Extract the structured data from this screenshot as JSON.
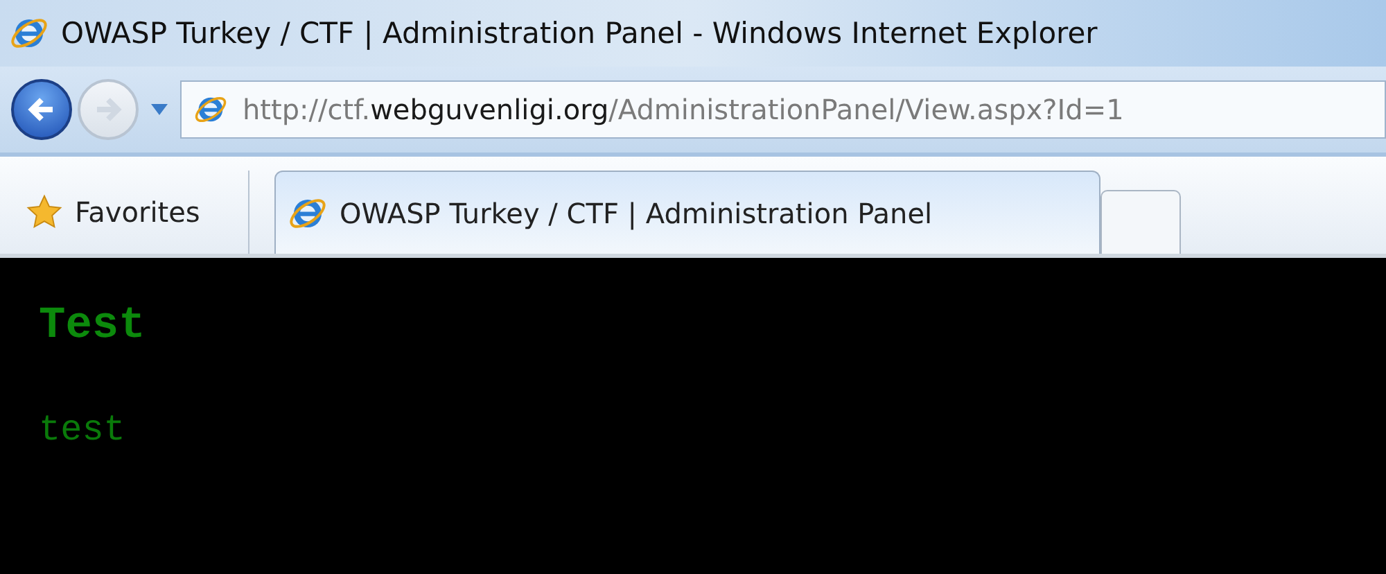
{
  "window": {
    "title": "OWASP Turkey / CTF | Administration Panel - Windows Internet Explorer"
  },
  "address_bar": {
    "url_prefix": "http://ctf.",
    "url_domain": "webguvenligi.org",
    "url_path": "/AdministrationPanel/View.aspx?Id=1"
  },
  "favorites": {
    "label": "Favorites"
  },
  "tabs": [
    {
      "label": "OWASP Turkey / CTF | Administration Panel",
      "selected": true
    }
  ],
  "page": {
    "heading": "Test",
    "body": "test"
  }
}
